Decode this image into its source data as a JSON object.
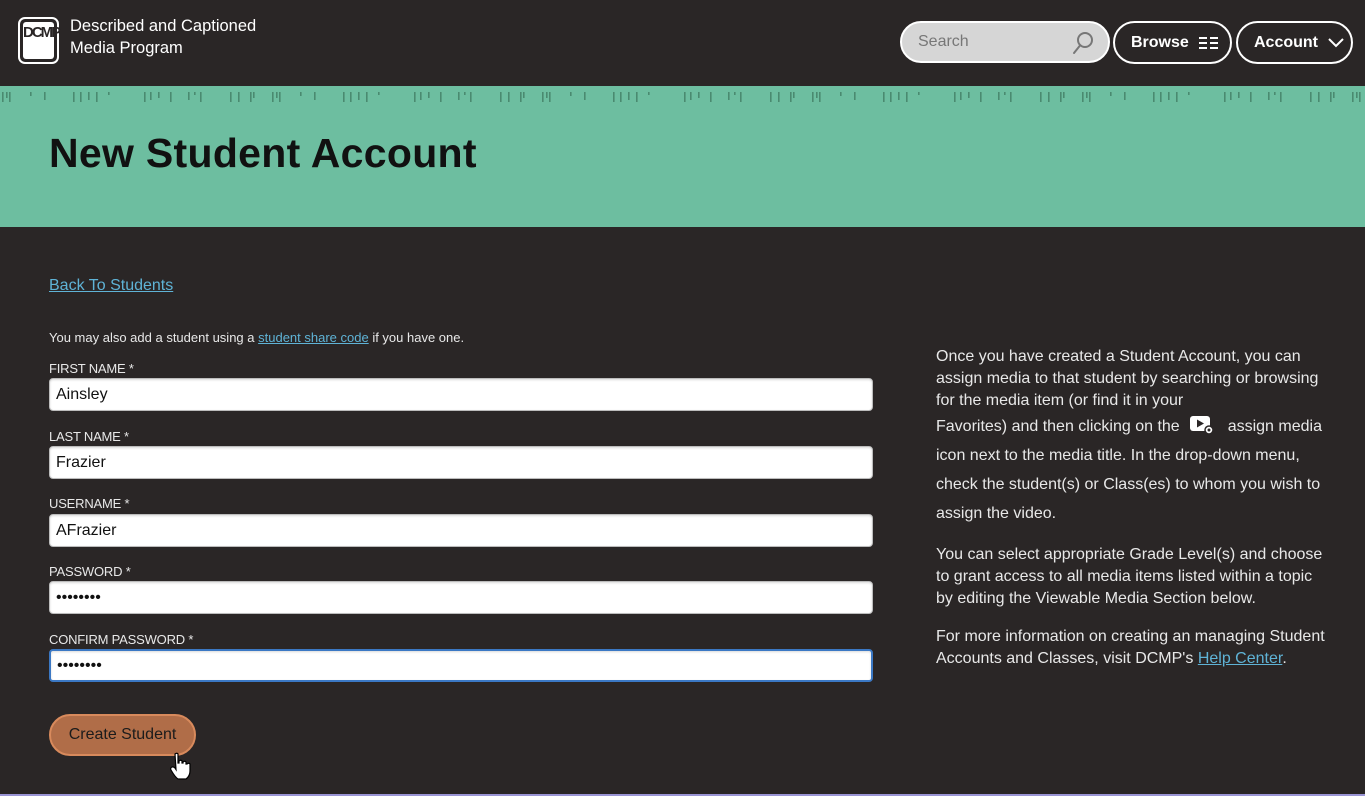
{
  "header": {
    "logo_text": "DCMP",
    "brand_line1": "Described and Captioned",
    "brand_line2": "Media Program",
    "search_placeholder": "Search",
    "search_value": "",
    "browse_label": "Browse",
    "account_label": "Account"
  },
  "banner": {
    "title": "New Student Account"
  },
  "main": {
    "back_link": "Back To Students",
    "share_note_prefix": "You may also add a student using a ",
    "share_note_link": "student share code",
    "share_note_suffix": " if you have one.",
    "fields": [
      {
        "label": "FIRST NAME *",
        "value": "Ainsley",
        "type": "text"
      },
      {
        "label": "LAST NAME *",
        "value": "Frazier",
        "type": "text"
      },
      {
        "label": "USERNAME *",
        "value": "AFrazier",
        "type": "text"
      },
      {
        "label": "PASSWORD *",
        "value": "••••••••",
        "type": "password"
      },
      {
        "label": "CONFIRM PASSWORD *",
        "value": "••••••••",
        "type": "password"
      }
    ],
    "submit_label": "Create Student"
  },
  "help": {
    "p1_line1": "Once you have created a Student Account, you can assign media to that student by searching or browsing for the media item (or find it in your",
    "p1_before_icon": "Favorites) and then clicking on the",
    "p1_icon": "assign-media-icon",
    "p1_after_icon": "assign media icon next to the media title. In the drop-down menu, check the student(s) or Class(es) to whom you wish to assign the video.",
    "p2": "You can select appropriate Grade Level(s) and choose to grant access to all media items listed within a topic by editing the Viewable Media Section below.",
    "p3_text": "For more information on creating an managing Student Accounts and Classes, visit DCMP's ",
    "p3_link": "Help Center",
    "p3_end": "."
  },
  "colors": {
    "background": "#2a2626",
    "banner": "#6dbea0",
    "link": "#5fb3d6",
    "button": "#b06d48",
    "focus": "#3b78c4"
  }
}
